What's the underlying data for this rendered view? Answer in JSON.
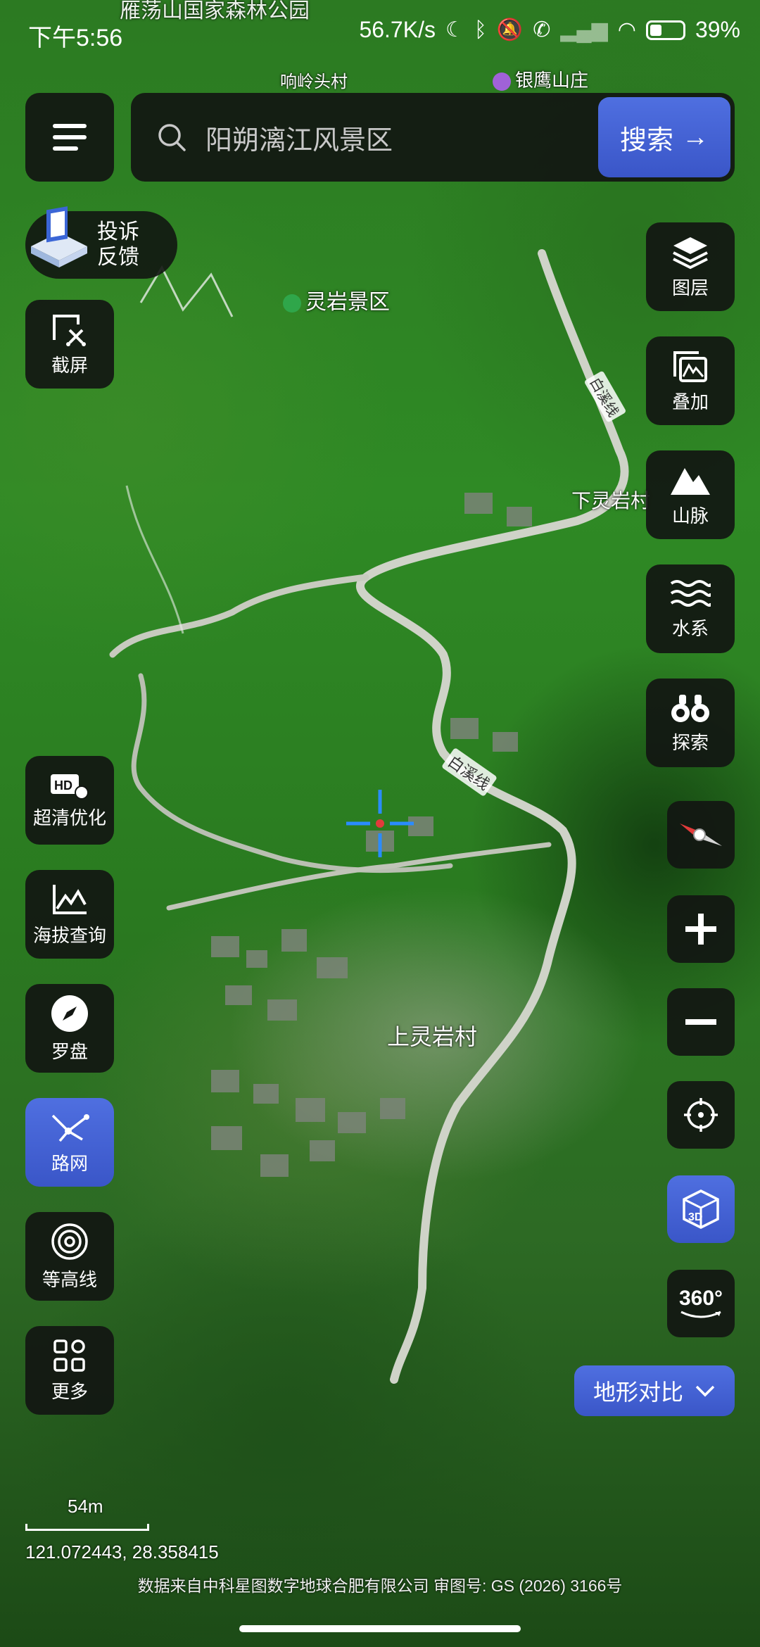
{
  "status_bar": {
    "time": "下午5:56",
    "network_speed": "56.7K/s",
    "battery_percent": "39%",
    "icons": [
      "moon-icon",
      "bluetooth-icon",
      "mute-icon",
      "call-icon",
      "signal-icon",
      "wifi-icon",
      "battery-icon"
    ]
  },
  "search": {
    "placeholder": "阳朔漓江风景区",
    "button_label": "搜索"
  },
  "feedback": {
    "line1": "投诉",
    "line2": "反馈"
  },
  "left_tools": [
    {
      "label": "截屏",
      "icon": "screenshot-icon"
    },
    {
      "label": "超清优化",
      "icon": "hd-icon"
    },
    {
      "label": "海拔查询",
      "icon": "elevation-icon"
    },
    {
      "label": "罗盘",
      "icon": "compass-icon"
    },
    {
      "label": "路网",
      "icon": "road-network-icon",
      "active": true
    },
    {
      "label": "等高线",
      "icon": "contour-icon"
    },
    {
      "label": "更多",
      "icon": "more-grid-icon"
    }
  ],
  "right_tools": [
    {
      "label": "图层",
      "icon": "layers-icon"
    },
    {
      "label": "叠加",
      "icon": "overlay-icon"
    },
    {
      "label": "山脉",
      "icon": "mountain-icon"
    },
    {
      "label": "水系",
      "icon": "water-icon"
    },
    {
      "label": "探索",
      "icon": "binoculars-icon"
    }
  ],
  "map_controls": {
    "compass": "compass-needle-icon",
    "zoom_in": "plus-icon",
    "zoom_out": "minus-icon",
    "locate": "locate-icon",
    "three_d": "3D",
    "panorama": "360°",
    "terrain_compare": "地形对比"
  },
  "map_labels": {
    "top_park": "雁荡山国家森林公园",
    "village1": "响岭头村",
    "villa": "银鹰山庄",
    "scenic": "灵岩景区",
    "village2": "下灵岩村",
    "village3": "上灵岩村",
    "road1": "白溪线",
    "road2": "白溪线"
  },
  "scale": {
    "value": "54m",
    "coordinates": "121.072443, 28.358415"
  },
  "copyright": "数据来自中科星图数字地球合肥有限公司 审图号: GS (2026) 3166号",
  "colors": {
    "accent_blue": "#4563d6",
    "button_dark": "#121612"
  }
}
